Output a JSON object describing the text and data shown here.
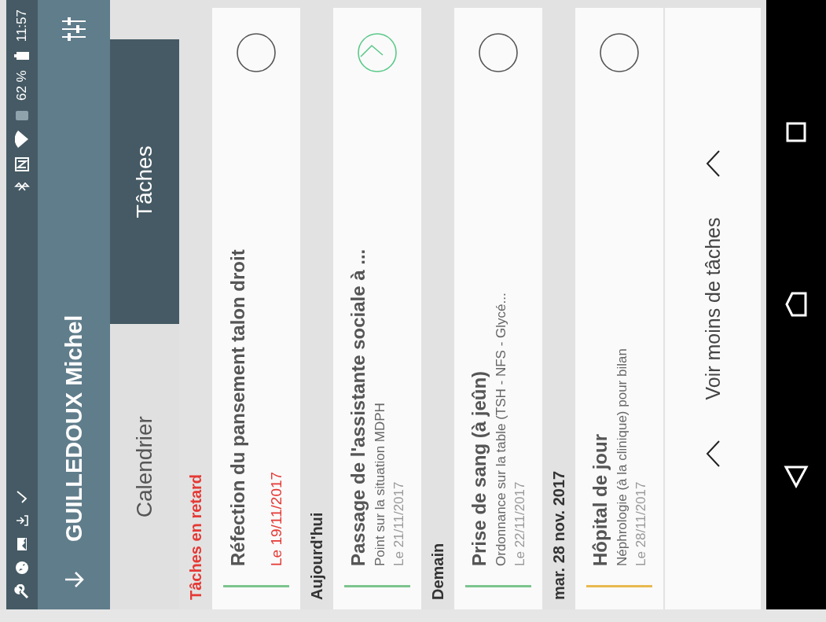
{
  "status_bar": {
    "battery": "62 %",
    "time": "11:57"
  },
  "toolbar": {
    "title": "GUILLEDOUX Michel"
  },
  "tabs": [
    {
      "label": "Calendrier",
      "selected": false
    },
    {
      "label": "Tâches",
      "selected": true
    }
  ],
  "sections": [
    {
      "title": "Tâches en retard",
      "overdue": true,
      "tasks": [
        {
          "title": "Réfection du pansement talon droit",
          "date": "Le 19/11/2017",
          "color": "#7cc48f",
          "done": false
        }
      ]
    },
    {
      "title": "Aujourd'hui",
      "overdue": false,
      "tasks": [
        {
          "title": "Passage de l'assistante sociale à ...",
          "subtitle": "Point sur la situation MDPH",
          "date": "Le 21/11/2017",
          "color": "#7cc48f",
          "done": true
        }
      ]
    },
    {
      "title": "Demain",
      "overdue": false,
      "tasks": [
        {
          "title": "Prise de sang (à jeûn)",
          "subtitle": "Ordonnance sur la table (TSH - NFS - Glycé...",
          "date": "Le 22/11/2017",
          "color": "#7cc48f",
          "done": false
        }
      ]
    },
    {
      "title": "mar. 28 nov. 2017",
      "overdue": false,
      "tasks": [
        {
          "title": "Hôpital de jour",
          "subtitle": "Néphrologie (à la clinique) pour bilan",
          "date": "Le 28/11/2017",
          "color": "#e8b94f",
          "done": false
        }
      ]
    }
  ],
  "footer": {
    "label": "Voir moins de tâches"
  }
}
